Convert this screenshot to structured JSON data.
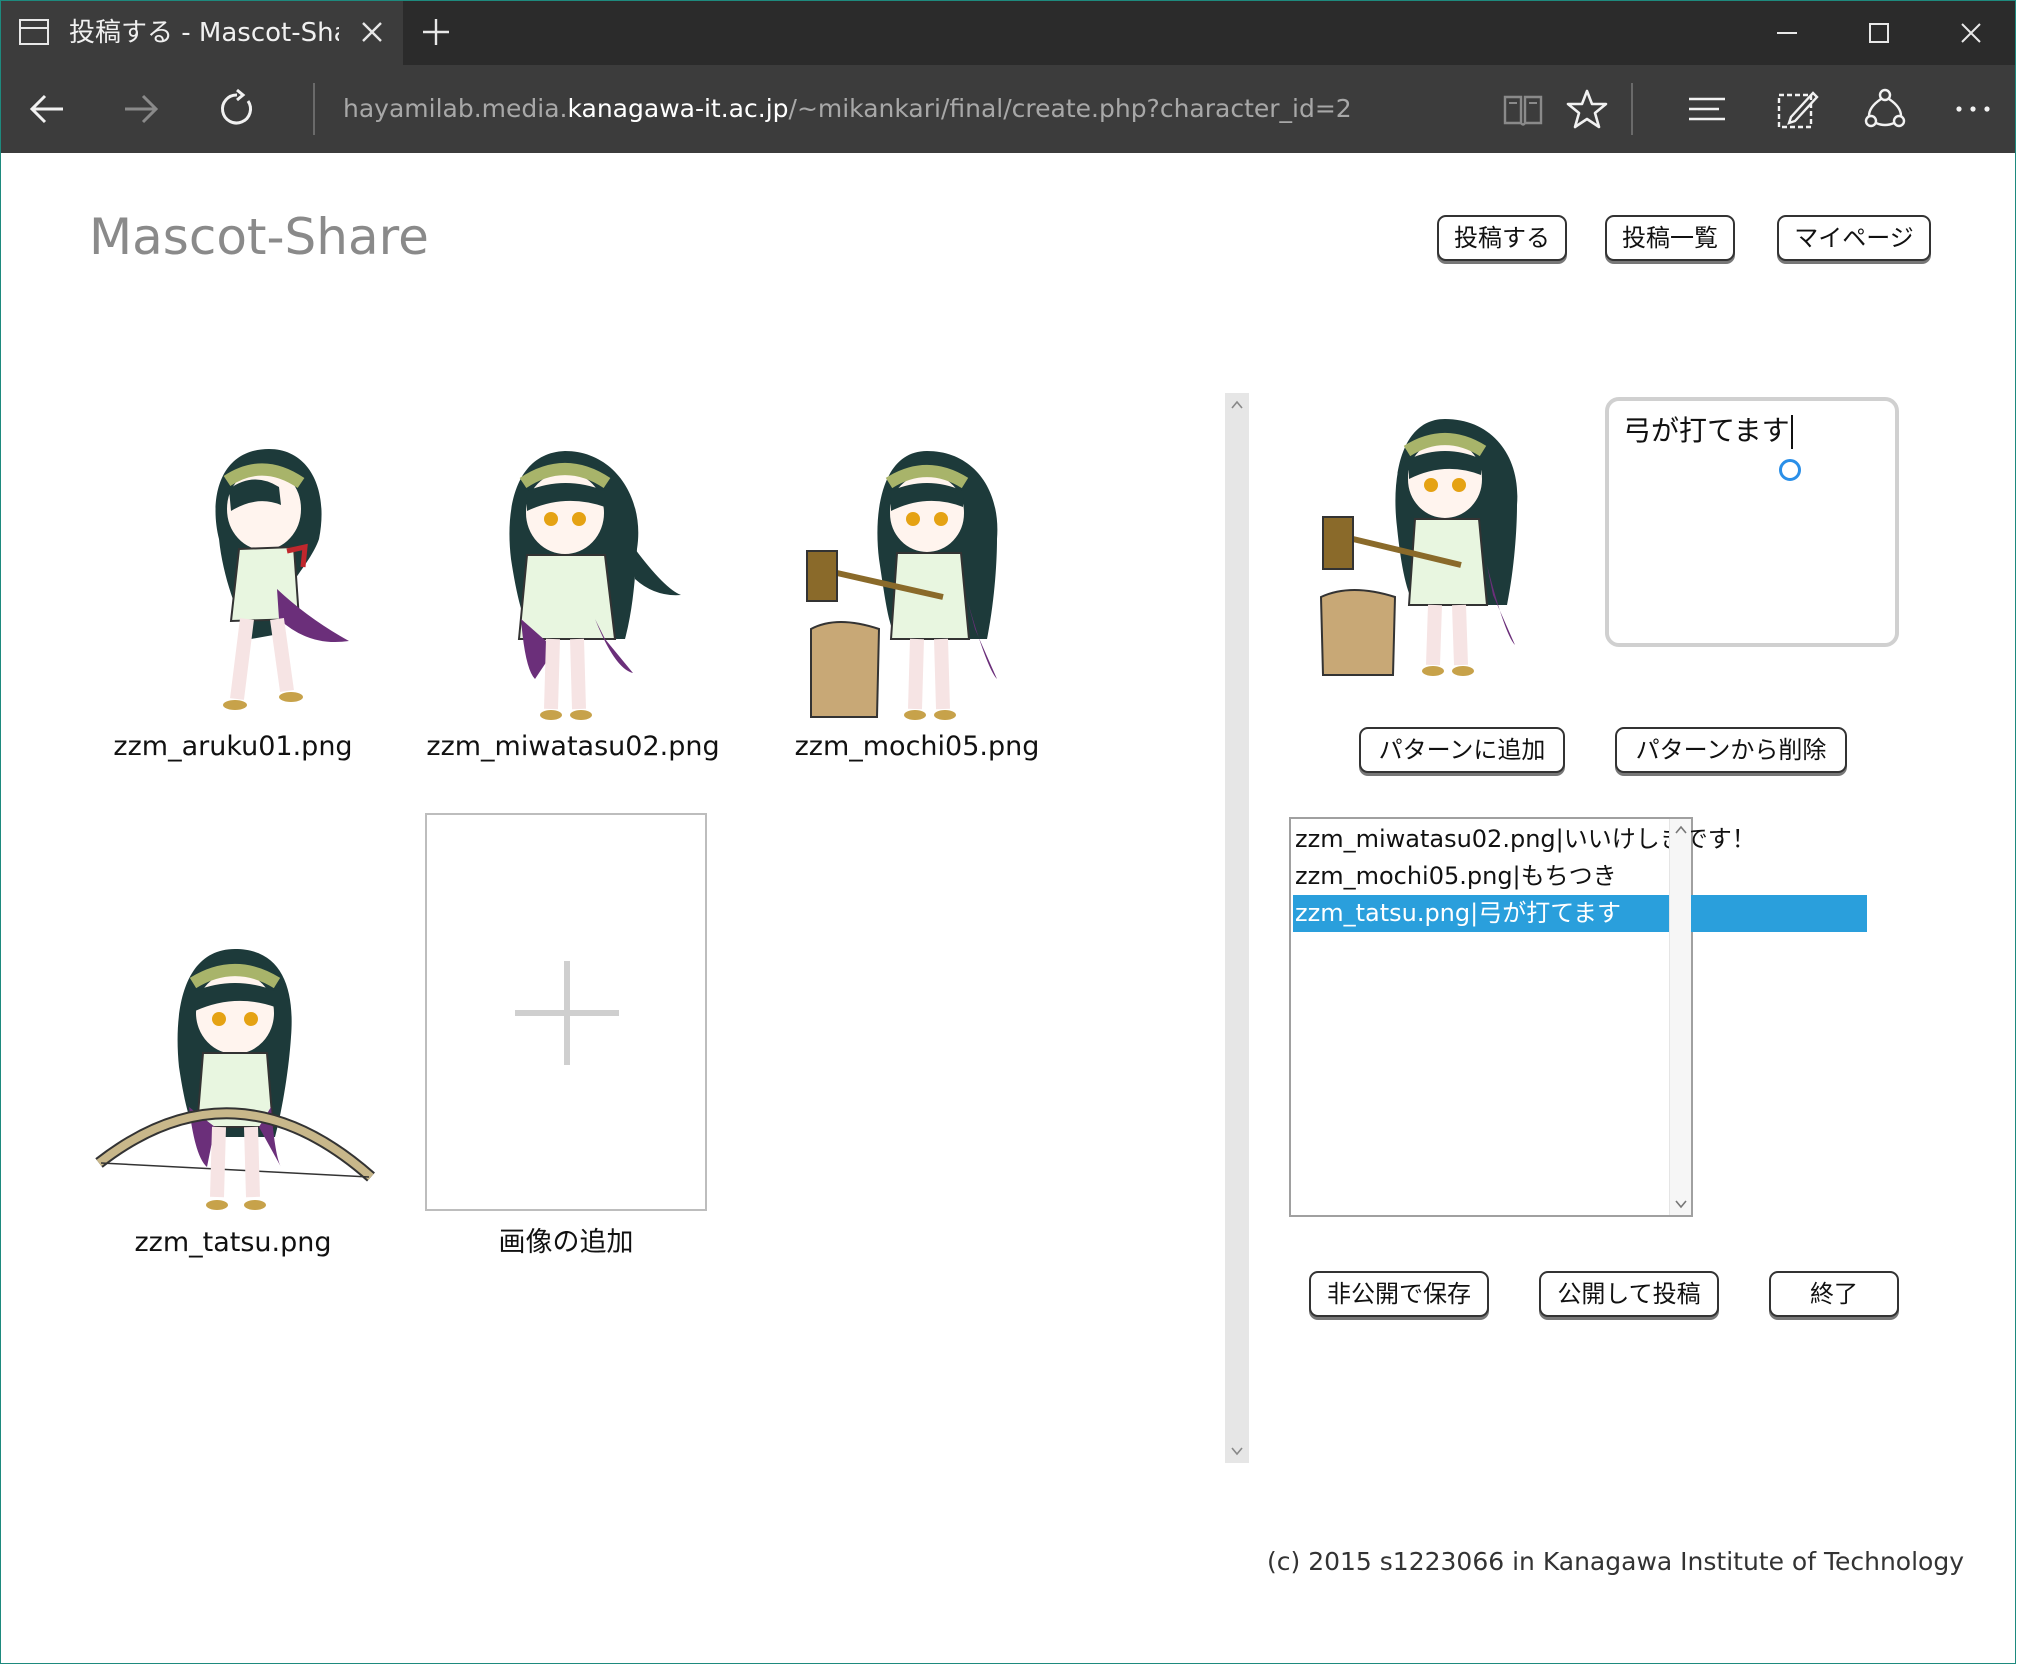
{
  "browser": {
    "tab_title": "投稿する - Mascot-Share",
    "url_prefix": "hayamilab.media.",
    "url_host": "kanagawa-it.ac.jp",
    "url_path": "/~mikankari/final/create.php?character_id=2",
    "icons": [
      "page-icon",
      "close-icon",
      "plus-icon",
      "minimize-icon",
      "maximize-icon",
      "close-icon",
      "back-arrow-icon",
      "forward-arrow-icon",
      "refresh-icon",
      "reading-view-icon",
      "star-icon",
      "hub-icon",
      "web-note-icon",
      "share-icon",
      "more-icon"
    ]
  },
  "site": {
    "title": "Mascot-Share",
    "nav": {
      "post": "投稿する",
      "list": "投稿一覧",
      "mypage": "マイページ"
    }
  },
  "gallery": {
    "images": [
      {
        "name": "zzm_aruku01.png"
      },
      {
        "name": "zzm_miwatasu02.png"
      },
      {
        "name": "zzm_mochi05.png"
      },
      {
        "name": "zzm_tatsu.png"
      }
    ],
    "add_label": "画像の追加"
  },
  "editor": {
    "text_value": "弓が打てます",
    "add_pattern": "パターンに追加",
    "remove_pattern": "パターンから削除",
    "patterns": [
      {
        "text": "zzm_miwatasu02.png|いいけしきです！",
        "selected": false
      },
      {
        "text": "zzm_mochi05.png|もちつき",
        "selected": false
      },
      {
        "text": "zzm_tatsu.png|弓が打てます",
        "selected": true
      }
    ],
    "save_private": "非公開で保存",
    "publish": "公開して投稿",
    "finish": "終了"
  },
  "footer": {
    "copyright": "(c) 2015 s1223066 in Kanagawa Institute of Technology"
  },
  "colors": {
    "accent": "#2a9fdc",
    "chrome_dark": "#2b2b2b",
    "chrome": "#3c3c3c",
    "hair": "#1d3a3a",
    "band": "#a8b46a",
    "skirt": "#6b2f7a",
    "kimono": "#e8f6e0"
  }
}
